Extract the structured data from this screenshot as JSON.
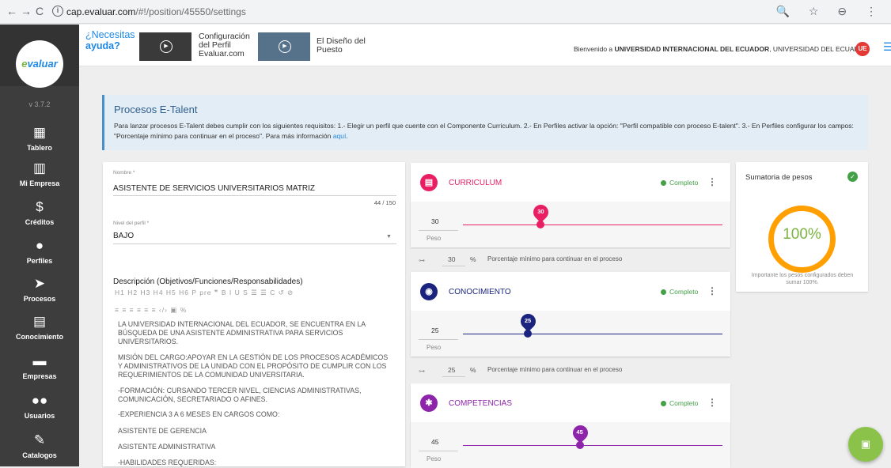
{
  "browser": {
    "url_domain": "cap.evaluar.com",
    "url_path": "/#!/position/45550/settings",
    "back": "←",
    "forward": "→",
    "reload": "C",
    "info": "i",
    "right_icons": "🔍 ☆ ⊖ ⋮"
  },
  "sidebar": {
    "logo_a": "e",
    "logo_b": "valuar",
    "version": "v 3.7.2",
    "items": [
      {
        "label": "Tablero",
        "icon": "▦"
      },
      {
        "label": "Mi Empresa",
        "icon": "▥"
      },
      {
        "label": "Créditos",
        "icon": "$"
      },
      {
        "label": "Perfiles",
        "icon": "●"
      },
      {
        "label": "Procesos",
        "icon": "➤"
      },
      {
        "label": "Conocimiento",
        "icon": "▤"
      },
      {
        "label": "Empresas",
        "icon": "▬"
      },
      {
        "label": "Usuarios",
        "icon": "●●"
      },
      {
        "label": "Catalogos",
        "icon": "✎"
      }
    ]
  },
  "topbar": {
    "help_line1": "¿Necesitas",
    "help_line2": "ayuda?",
    "video1": [
      "Configuración",
      "del Perfil",
      "Evaluar.com"
    ],
    "video2": [
      "El Diseño del",
      "Puesto"
    ],
    "welcome_prefix": "Bienvenido a ",
    "welcome_org": "UNIVERSIDAD INTERNACIONAL DEL ECUADOR",
    "welcome_suffix": ", UNIVERSIDAD DEL ECUADOR",
    "avatar": "UE"
  },
  "notice": {
    "title": "Procesos E-Talent",
    "text": "Para lanzar procesos E-Talent debes cumplir con los siguientes requisitos: 1.- Elegir un perfil que cuente con el Componente Curriculum. 2.- En Perfiles activar la opción: \"Perfil compatible con proceso E-talent\". 3.- En Perfiles configurar los campos: \"Porcentaje mínimo para continuar en el proceso\". Para más información ",
    "link": "aquí",
    "end": "."
  },
  "form": {
    "name_label": "Nombre *",
    "name_value": "ASISTENTE DE SERVICIOS UNIVERSITARIOS MATRIZ",
    "name_counter": "44 / 150",
    "level_label": "Nivel del perfil *",
    "level_value": "BAJO",
    "desc_label": "Descripción (Objetivos/Funciones/Responsabilidades)",
    "toolbar1": "H1 H2 H3 H4 H5 H6 P pre ❞ B I U S ☰ ☰ C ↺ ⊘",
    "toolbar2": "≡ ≡ ≡ ≡ ≡ ≡ ‹/› ▣ %",
    "desc": [
      "LA UNIVERSIDAD INTERNACIONAL DEL ECUADOR, SE ENCUENTRA EN LA BÚSQUEDA DE UNA ASISTENTE ADMINISTRATIVA PARA SERVICIOS UNIVERSITARIOS.",
      "MISIÓN DEL CARGO:APOYAR EN LA GESTIÓN DE LOS PROCESOS ACADÉMICOS Y ADMINISTRATIVOS  DE LA UNIDAD CON EL PROPÓSITO DE CUMPLIR CON LOS REQUERIMIENTOS DE LA COMUNIDAD UNIVERSITARIA.",
      "-FORMACIÓN: CURSANDO TERCER NIVEL, CIENCIAS ADMINISTRATIVAS, COMUNICACIÓN, SECRETARIADO O AFINES.",
      "-EXPERIENCIA 3 A 6 MESES EN CARGOS COMO:",
      "ASISTENTE DE GERENCIA",
      "ASISTENTE ADMINISTRATIVA",
      "-HABILIDADES REQUERIDAS:"
    ]
  },
  "sections": [
    {
      "title": "CURRICULUM",
      "icon": "▤",
      "color": "#e91e63",
      "status": "Completo",
      "menu": "⋮",
      "peso": "30",
      "peso_label": "Peso",
      "min": "30",
      "min_value": 30,
      "pct": "%",
      "min_text": "Porcentaje mínimo para continuar en el proceso",
      "key": "⊶"
    },
    {
      "title": "CONOCIMIENTO",
      "icon": "◉",
      "color": "#1a237e",
      "status": "Completo",
      "menu": "⋮",
      "peso": "25",
      "peso_label": "Peso",
      "min": "25",
      "min_value": 25,
      "pct": "%",
      "min_text": "Porcentaje mínimo para continuar en el proceso",
      "key": "⊶"
    },
    {
      "title": "COMPETENCIAS",
      "icon": "✱",
      "color": "#8e24aa",
      "status": "Completo",
      "menu": "⋮",
      "peso": "45",
      "peso_label": "Peso"
    }
  ],
  "sum": {
    "title": "Sumatoria de pesos",
    "check": "✓",
    "value": "100%",
    "note": "Importante los pesos configurados deben sumar 100%."
  },
  "fab": {
    "icon": "▣"
  }
}
